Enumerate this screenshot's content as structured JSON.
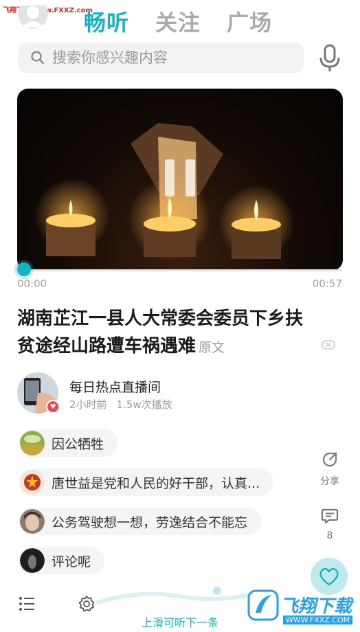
{
  "watermark_top": "飞翔下载 www.FXXZ.com",
  "tabs": [
    "畅听",
    "关注",
    "广场"
  ],
  "search": {
    "placeholder": "搜索你感兴趣内容"
  },
  "player": {
    "current_time": "00:00",
    "duration": "00:57",
    "progress": 0.0
  },
  "article": {
    "title": "湖南芷江一县人大常委会委员下乡扶贫途经山路遭车祸遇难",
    "original_link": "原文"
  },
  "channel": {
    "name": "每日热点直播间",
    "posted": "2小时前",
    "plays": "1.5w次播放"
  },
  "comments": [
    {
      "text": "因公牺牲"
    },
    {
      "text": "唐世益是党和人民的好干部，认真..."
    },
    {
      "text": "公务驾驶想一想，劳逸结合不能忘"
    },
    {
      "text": "评论呢"
    }
  ],
  "actions": {
    "share_label": "分享",
    "comment_count": "8"
  },
  "bottom": {
    "hint": "上滑可听下一条"
  },
  "watermark_logo": {
    "text": "飞翔下载",
    "url": "WWW.FXXZ.COM"
  },
  "colors": {
    "accent": "#17b3c0",
    "tab_inactive": "#a9a9a9",
    "live_badge": "#ff3c4c"
  }
}
